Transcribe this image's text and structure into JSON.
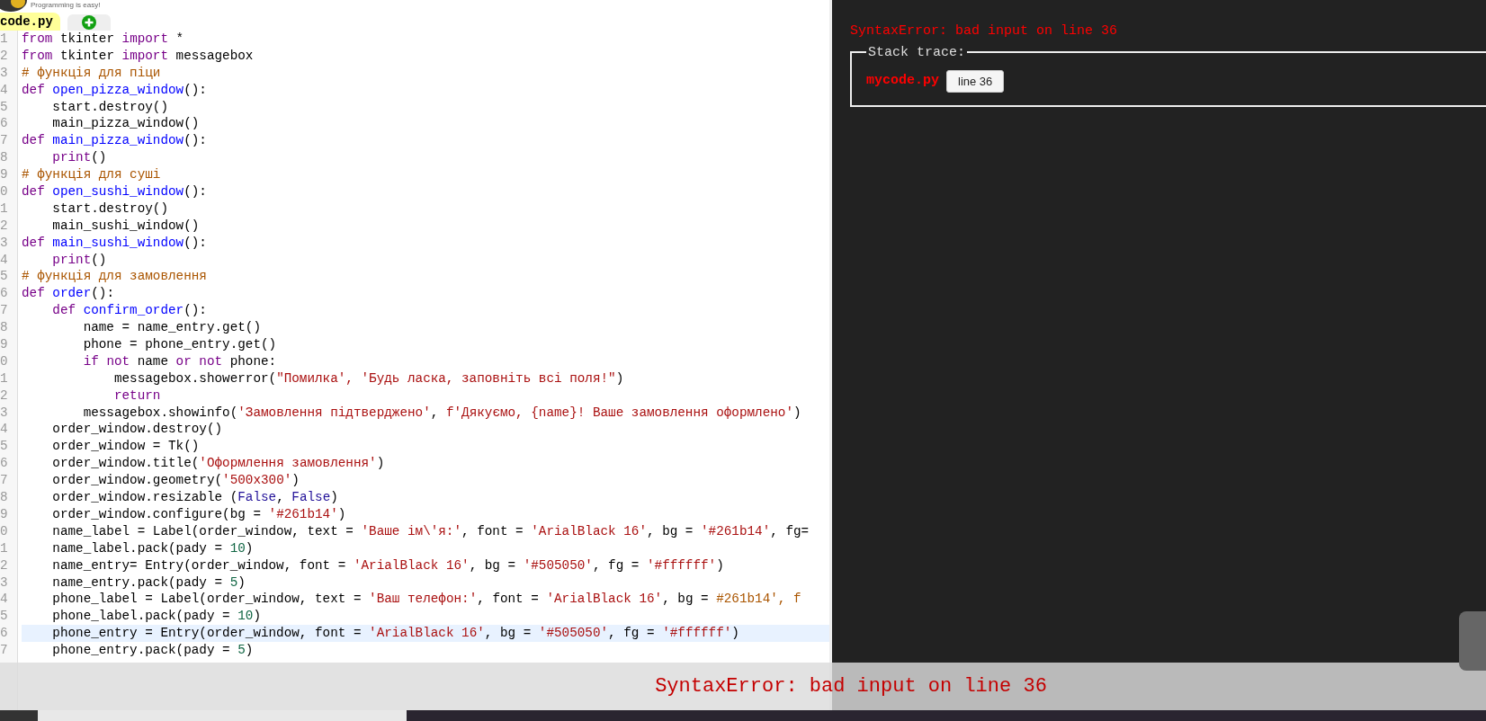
{
  "header": {
    "tagline": "Programming is easy!"
  },
  "tabs": [
    {
      "kind": "file",
      "label": "code.py",
      "selected": true
    },
    {
      "kind": "add",
      "selected": false
    }
  ],
  "editor": {
    "lines": [
      {
        "number": "1",
        "selected": false,
        "tokens": [
          {
            "kind": "keyword",
            "text": "from"
          },
          {
            "kind": "plain",
            "text": " tkinter "
          },
          {
            "kind": "keyword",
            "text": "import"
          },
          {
            "kind": "plain",
            "text": " *"
          }
        ]
      },
      {
        "number": "2",
        "selected": false,
        "tokens": [
          {
            "kind": "keyword",
            "text": "from"
          },
          {
            "kind": "plain",
            "text": " tkinter "
          },
          {
            "kind": "keyword",
            "text": "import"
          },
          {
            "kind": "plain",
            "text": " messagebox"
          }
        ]
      },
      {
        "number": "3",
        "selected": false,
        "tokens": [
          {
            "kind": "comment",
            "text": "# функція для піци"
          }
        ]
      },
      {
        "number": "4",
        "selected": false,
        "tokens": [
          {
            "kind": "keyword",
            "text": "def"
          },
          {
            "kind": "defname",
            "text": " open_pizza_window"
          },
          {
            "kind": "plain",
            "text": "():"
          }
        ]
      },
      {
        "number": "5",
        "selected": false,
        "tokens": [
          {
            "kind": "plain",
            "text": "    start.destroy()"
          }
        ]
      },
      {
        "number": "6",
        "selected": false,
        "tokens": [
          {
            "kind": "plain",
            "text": "    main_pizza_window()"
          }
        ]
      },
      {
        "number": "7",
        "selected": false,
        "tokens": [
          {
            "kind": "keyword",
            "text": "def"
          },
          {
            "kind": "defname",
            "text": " main_pizza_window"
          },
          {
            "kind": "plain",
            "text": "():"
          }
        ]
      },
      {
        "number": "8",
        "selected": false,
        "tokens": [
          {
            "kind": "keyword",
            "text": "    print"
          },
          {
            "kind": "plain",
            "text": "()"
          }
        ]
      },
      {
        "number": "9",
        "selected": false,
        "tokens": [
          {
            "kind": "comment",
            "text": "# функція для суші"
          }
        ]
      },
      {
        "number": "0",
        "selected": false,
        "tokens": [
          {
            "kind": "keyword",
            "text": "def"
          },
          {
            "kind": "defname",
            "text": " open_sushi_window"
          },
          {
            "kind": "plain",
            "text": "():"
          }
        ]
      },
      {
        "number": "1",
        "selected": false,
        "tokens": [
          {
            "kind": "plain",
            "text": "    start.destroy()"
          }
        ]
      },
      {
        "number": "2",
        "selected": false,
        "tokens": [
          {
            "kind": "plain",
            "text": "    main_sushi_window()"
          }
        ]
      },
      {
        "number": "3",
        "selected": false,
        "tokens": [
          {
            "kind": "keyword",
            "text": "def"
          },
          {
            "kind": "defname",
            "text": " main_sushi_window"
          },
          {
            "kind": "plain",
            "text": "():"
          }
        ]
      },
      {
        "number": "4",
        "selected": false,
        "tokens": [
          {
            "kind": "keyword",
            "text": "    print"
          },
          {
            "kind": "plain",
            "text": "()"
          }
        ]
      },
      {
        "number": "5",
        "selected": false,
        "tokens": [
          {
            "kind": "comment",
            "text": "# функція для замовлення"
          }
        ]
      },
      {
        "number": "6",
        "selected": false,
        "tokens": [
          {
            "kind": "keyword",
            "text": "def"
          },
          {
            "kind": "defname",
            "text": " order"
          },
          {
            "kind": "plain",
            "text": "():"
          }
        ]
      },
      {
        "number": "7",
        "selected": false,
        "tokens": [
          {
            "kind": "keyword",
            "text": "    def"
          },
          {
            "kind": "defname",
            "text": " confirm_order"
          },
          {
            "kind": "plain",
            "text": "():"
          }
        ]
      },
      {
        "number": "8",
        "selected": false,
        "tokens": [
          {
            "kind": "plain",
            "text": "        name = name_entry.get()"
          }
        ]
      },
      {
        "number": "9",
        "selected": false,
        "tokens": [
          {
            "kind": "plain",
            "text": "        phone = phone_entry.get()"
          }
        ]
      },
      {
        "number": "0",
        "selected": false,
        "tokens": [
          {
            "kind": "keyword",
            "text": "        if"
          },
          {
            "kind": "keyword",
            "text": " not"
          },
          {
            "kind": "plain",
            "text": " name "
          },
          {
            "kind": "keyword",
            "text": "or"
          },
          {
            "kind": "keyword",
            "text": " not"
          },
          {
            "kind": "plain",
            "text": " phone:"
          }
        ]
      },
      {
        "number": "1",
        "selected": false,
        "tokens": [
          {
            "kind": "plain",
            "text": "            messagebox.showerror("
          },
          {
            "kind": "string",
            "text": "\"Помилка', 'Будь ласка, заповніть всі поля!\""
          },
          {
            "kind": "plain",
            "text": ")"
          }
        ]
      },
      {
        "number": "2",
        "selected": false,
        "tokens": [
          {
            "kind": "keyword",
            "text": "            return"
          }
        ]
      },
      {
        "number": "3",
        "selected": false,
        "tokens": [
          {
            "kind": "plain",
            "text": "        messagebox.showinfo("
          },
          {
            "kind": "string",
            "text": "'Замовлення підтверджено'"
          },
          {
            "kind": "plain",
            "text": ","
          },
          {
            "kind": "string",
            "text": " f'Дякуємо, {name}! Ваше замовлення оформлено'"
          },
          {
            "kind": "plain",
            "text": ")"
          }
        ]
      },
      {
        "number": "4",
        "selected": false,
        "tokens": [
          {
            "kind": "plain",
            "text": "    order_window.destroy()"
          }
        ]
      },
      {
        "number": "5",
        "selected": false,
        "tokens": [
          {
            "kind": "plain",
            "text": "    order_window = Tk()"
          }
        ]
      },
      {
        "number": "6",
        "selected": false,
        "tokens": [
          {
            "kind": "plain",
            "text": "    order_window.title("
          },
          {
            "kind": "string",
            "text": "'Оформлення замовлення'"
          },
          {
            "kind": "plain",
            "text": ")"
          }
        ]
      },
      {
        "number": "7",
        "selected": false,
        "tokens": [
          {
            "kind": "plain",
            "text": "    order_window.geometry("
          },
          {
            "kind": "string",
            "text": "'500x300'"
          },
          {
            "kind": "plain",
            "text": ")"
          }
        ]
      },
      {
        "number": "8",
        "selected": false,
        "tokens": [
          {
            "kind": "plain",
            "text": "    order_window.resizable ("
          },
          {
            "kind": "atom",
            "text": "False"
          },
          {
            "kind": "plain",
            "text": ","
          },
          {
            "kind": "atom",
            "text": " False"
          },
          {
            "kind": "plain",
            "text": ")"
          }
        ]
      },
      {
        "number": "9",
        "selected": false,
        "tokens": [
          {
            "kind": "plain",
            "text": "    order_window.configure(bg = "
          },
          {
            "kind": "string",
            "text": "'#261b14'"
          },
          {
            "kind": "plain",
            "text": ")"
          }
        ]
      },
      {
        "number": "0",
        "selected": false,
        "tokens": [
          {
            "kind": "plain",
            "text": "    name_label = Label(order_window, text = "
          },
          {
            "kind": "string",
            "text": "'Ваше ім\\'я:'"
          },
          {
            "kind": "plain",
            "text": ", font = "
          },
          {
            "kind": "string",
            "text": "'ArialBlack 16'"
          },
          {
            "kind": "plain",
            "text": ", bg = "
          },
          {
            "kind": "string",
            "text": "'#261b14'"
          },
          {
            "kind": "plain",
            "text": ", fg="
          }
        ]
      },
      {
        "number": "1",
        "selected": false,
        "tokens": [
          {
            "kind": "plain",
            "text": "    name_label.pack(pady = "
          },
          {
            "kind": "number",
            "text": "10"
          },
          {
            "kind": "plain",
            "text": ")"
          }
        ]
      },
      {
        "number": "2",
        "selected": false,
        "tokens": [
          {
            "kind": "plain",
            "text": "    name_entry= Entry(order_window, font = "
          },
          {
            "kind": "string",
            "text": "'ArialBlack 16'"
          },
          {
            "kind": "plain",
            "text": ", bg = "
          },
          {
            "kind": "string",
            "text": "'#505050'"
          },
          {
            "kind": "plain",
            "text": ", fg = "
          },
          {
            "kind": "string",
            "text": "'#ffffff'"
          },
          {
            "kind": "plain",
            "text": ")"
          }
        ]
      },
      {
        "number": "3",
        "selected": false,
        "tokens": [
          {
            "kind": "plain",
            "text": "    name_entry.pack(pady = "
          },
          {
            "kind": "number",
            "text": "5"
          },
          {
            "kind": "plain",
            "text": ")"
          }
        ]
      },
      {
        "number": "4",
        "selected": false,
        "tokens": [
          {
            "kind": "plain",
            "text": "    phone_label = Label(order_window, text = "
          },
          {
            "kind": "string",
            "text": "'Ваш телефон:'"
          },
          {
            "kind": "plain",
            "text": ", font = "
          },
          {
            "kind": "string",
            "text": "'ArialBlack 16'"
          },
          {
            "kind": "plain",
            "text": ", bg = "
          },
          {
            "kind": "comment",
            "text": "#261b14', f"
          }
        ]
      },
      {
        "number": "5",
        "selected": false,
        "tokens": [
          {
            "kind": "plain",
            "text": "    phone_label.pack(pady = "
          },
          {
            "kind": "number",
            "text": "10"
          },
          {
            "kind": "plain",
            "text": ")"
          }
        ]
      },
      {
        "number": "6",
        "selected": true,
        "tokens": [
          {
            "kind": "plain",
            "text": "    phone_entry = Entry(order_window, font = "
          },
          {
            "kind": "string",
            "text": "'ArialBlack 16'"
          },
          {
            "kind": "plain",
            "text": ", bg = "
          },
          {
            "kind": "string",
            "text": "'#505050'"
          },
          {
            "kind": "plain",
            "text": ", fg = "
          },
          {
            "kind": "string",
            "text": "'#ffffff'"
          },
          {
            "kind": "plain",
            "text": ")"
          }
        ]
      },
      {
        "number": "7",
        "selected": false,
        "tokens": [
          {
            "kind": "plain",
            "text": "    phone_entry.pack(pady = "
          },
          {
            "kind": "number",
            "text": "5"
          },
          {
            "kind": "plain",
            "text": ")"
          }
        ]
      }
    ]
  },
  "output": {
    "error": "SyntaxError: bad input on line 36",
    "stack_trace": {
      "legend": "Stack trace:",
      "file": "mycode.py",
      "line_button": "line 36"
    }
  },
  "toast": {
    "message": "SyntaxError: bad input on line 36"
  }
}
